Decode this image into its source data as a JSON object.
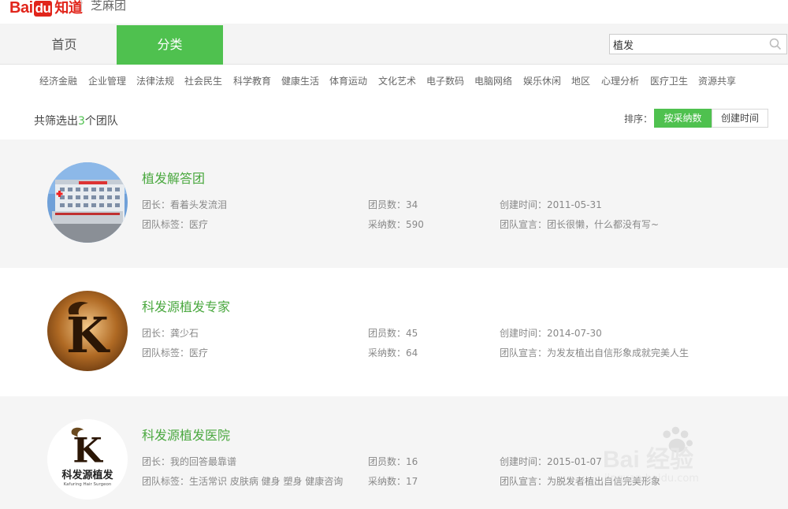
{
  "header": {
    "logo_bai": "Bai",
    "logo_du": "du",
    "logo_zhidao": "知道",
    "brand": "芝麻团"
  },
  "nav": {
    "home": "首页",
    "category": "分类",
    "search_value": "植发"
  },
  "categories": [
    "经济金融",
    "企业管理",
    "法律法规",
    "社会民生",
    "科学教育",
    "健康生活",
    "体育运动",
    "文化艺术",
    "电子数码",
    "电脑网络",
    "娱乐休闲",
    "地区",
    "心理分析",
    "医疗卫生",
    "资源共享"
  ],
  "summary": {
    "prefix": "共筛选出",
    "count": "3",
    "suffix": "个团队"
  },
  "sort": {
    "label": "排序：",
    "by_adopted": "按采纳数",
    "by_created": "创建时间"
  },
  "teams": [
    {
      "name": "植发解答团",
      "leader": "团长：看着头发流泪",
      "tags": "团队标签：医疗",
      "members": "团员数：34",
      "adopted": "采纳数：590",
      "created": "创建时间：2011-05-31",
      "motto": "团队宣言：团长很懒，什么都没有写~"
    },
    {
      "name": "科发源植发专家",
      "leader": "团长：龚少石",
      "tags": "团队标签：医疗",
      "members": "团员数：45",
      "adopted": "采纳数：64",
      "created": "创建时间：2014-07-30",
      "motto": "团队宣言：为发友植出自信形象成就完美人生"
    },
    {
      "name": "科发源植发医院",
      "leader": "团长：我的回答最靠谱",
      "tags": "团队标签：生活常识 皮肤病 健身 塑身 健康咨询",
      "members": "团员数：16",
      "adopted": "采纳数：17",
      "created": "创建时间：2015-01-07",
      "motto": "团队宣言：为脱发者植出自信完美形象",
      "logo_text": "科发源植发",
      "logo_sub": "Kafuring Hair Surgeon"
    }
  ],
  "watermark": {
    "main": "Bai 经验",
    "sub": "jingyan.baidu.com"
  },
  "colors": {
    "accent": "#4fc14f",
    "team_name": "#4aa83f",
    "baidu_red": "#e1251b"
  }
}
